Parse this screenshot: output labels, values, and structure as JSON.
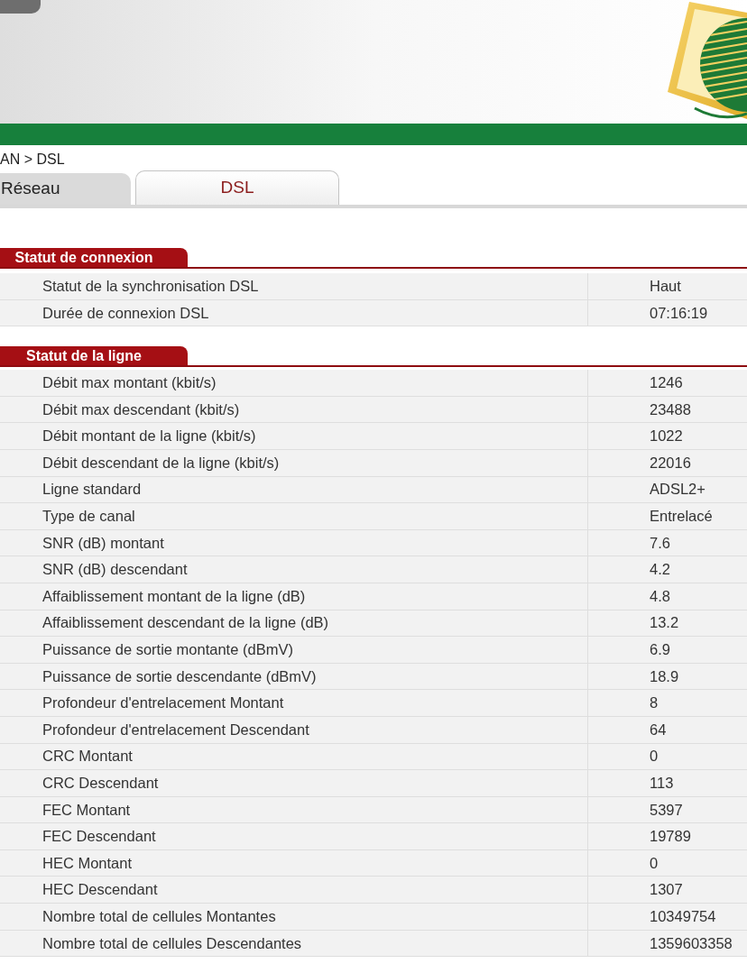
{
  "breadcrumb": "AN > DSL",
  "tabs": [
    {
      "label": "Réseau",
      "selected": false
    },
    {
      "label": "DSL",
      "selected": true
    }
  ],
  "sections": [
    {
      "title": "Statut de connexion",
      "rows": [
        {
          "label": "Statut de la synchronisation DSL",
          "value": "Haut"
        },
        {
          "label": "Durée de connexion DSL",
          "value": "07:16:19"
        }
      ]
    },
    {
      "title": "Statut de la ligne",
      "rows": [
        {
          "label": "Débit max montant (kbit/s)",
          "value": "1246"
        },
        {
          "label": "Débit max descendant (kbit/s)",
          "value": "23488"
        },
        {
          "label": "Débit montant de la ligne (kbit/s)",
          "value": "1022"
        },
        {
          "label": "Débit descendant de la ligne (kbit/s)",
          "value": "22016"
        },
        {
          "label": "Ligne standard",
          "value": "ADSL2+"
        },
        {
          "label": "Type de canal",
          "value": "Entrelacé"
        },
        {
          "label": "SNR (dB) montant",
          "value": "7.6"
        },
        {
          "label": "SNR (dB) descendant",
          "value": "4.2"
        },
        {
          "label": "Affaiblissement montant de la ligne (dB)",
          "value": "4.8"
        },
        {
          "label": "Affaiblissement descendant de la ligne (dB)",
          "value": "13.2"
        },
        {
          "label": "Puissance de sortie montante (dBmV)",
          "value": "6.9"
        },
        {
          "label": "Puissance de sortie descendante (dBmV)",
          "value": "18.9"
        },
        {
          "label": "Profondeur d'entrelacement Montant",
          "value": "8"
        },
        {
          "label": "Profondeur d'entrelacement Descendant",
          "value": "64"
        },
        {
          "label": "CRC Montant",
          "value": "0"
        },
        {
          "label": "CRC Descendant",
          "value": "113"
        },
        {
          "label": "FEC Montant",
          "value": "5397"
        },
        {
          "label": "FEC Descendant",
          "value": "19789"
        },
        {
          "label": "HEC Montant",
          "value": "0"
        },
        {
          "label": "HEC Descendant",
          "value": "1307"
        },
        {
          "label": "Nombre total de cellules Montantes",
          "value": "10349754"
        },
        {
          "label": "Nombre total de cellules Descendantes",
          "value": "1359603358"
        }
      ]
    }
  ]
}
